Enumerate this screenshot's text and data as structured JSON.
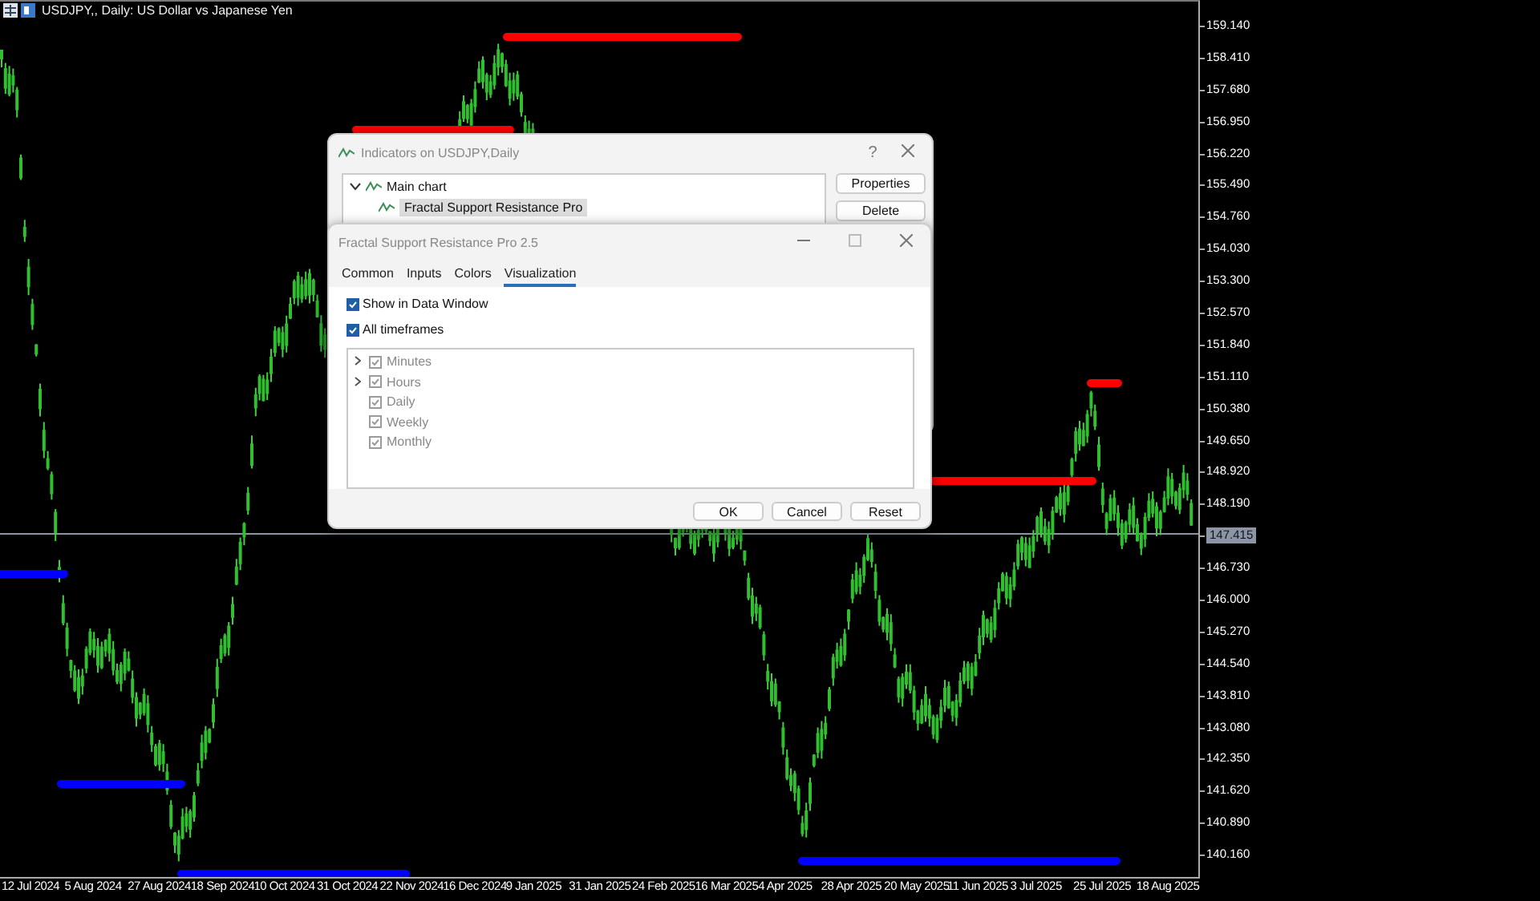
{
  "chart": {
    "title": "USDJPY,, Daily:  US Dollar vs Japanese Yen",
    "price_axis": [
      "159.140",
      "158.410",
      "157.680",
      "156.950",
      "156.220",
      "155.490",
      "154.760",
      "154.030",
      "153.300",
      "152.570",
      "151.840",
      "151.110",
      "150.380",
      "149.650",
      "148.920",
      "148.190",
      "146.730",
      "146.000",
      "145.270",
      "144.540",
      "143.810",
      "143.080",
      "142.350",
      "141.620",
      "140.890",
      "140.160"
    ],
    "current_price": "147.415",
    "time_axis": [
      "12 Jul 2024",
      "5 Aug 2024",
      "27 Aug 2024",
      "18 Sep 2024",
      "10 Oct 2024",
      "31 Oct 2024",
      "22 Nov 2024",
      "16 Dec 2024",
      "9 Jan 2025",
      "31 Jan 2025",
      "24 Feb 2025",
      "16 Mar 2025",
      "4 Apr 2025",
      "28 Apr 2025",
      "20 May 2025",
      "11 Jun 2025",
      "3 Jul 2025",
      "25 Jul 2025",
      "18 Aug 2025"
    ]
  },
  "indicators_dialog": {
    "title": "Indicators on USDJPY,Daily",
    "help": "?",
    "tree": [
      {
        "label": "Main chart",
        "expanded": true,
        "selected": false,
        "children": [
          {
            "label": "Fractal Support  Resistance Pro",
            "selected": true
          }
        ]
      }
    ],
    "buttons": [
      "Properties",
      "Delete"
    ]
  },
  "properties_dialog": {
    "title": "Fractal Support  Resistance Pro 2.5",
    "tabs": [
      {
        "label": "Common",
        "selected": false
      },
      {
        "label": "Inputs",
        "selected": false
      },
      {
        "label": "Colors",
        "selected": false
      },
      {
        "label": "Visualization",
        "selected": true
      }
    ],
    "options": [
      {
        "label": "Show in Data Window",
        "checked": true
      },
      {
        "label": "All timeframes",
        "checked": true
      }
    ],
    "timeframes": [
      {
        "label": "Minutes",
        "expandable": true,
        "checked": true,
        "disabled": true
      },
      {
        "label": "Hours",
        "expandable": true,
        "checked": true,
        "disabled": true
      },
      {
        "label": "Daily",
        "expandable": false,
        "checked": true,
        "disabled": true
      },
      {
        "label": "Weekly",
        "expandable": false,
        "checked": true,
        "disabled": true
      },
      {
        "label": "Monthly",
        "expandable": false,
        "checked": true,
        "disabled": true
      }
    ],
    "buttons": [
      "OK",
      "Cancel",
      "Reset"
    ]
  }
}
